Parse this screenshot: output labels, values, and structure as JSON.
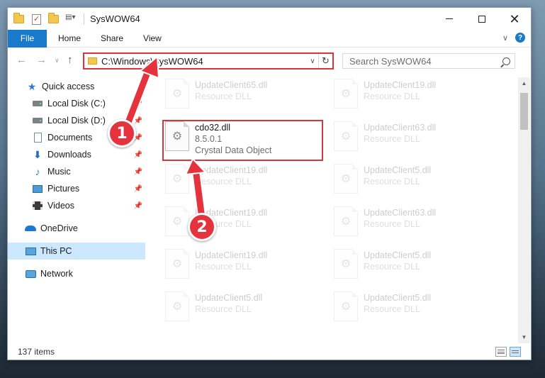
{
  "window": {
    "title": "SysWOW64"
  },
  "ribbon": {
    "tabs": [
      "File",
      "Home",
      "Share",
      "View"
    ],
    "help_label": "?"
  },
  "address": {
    "path": "C:\\Windows\\SysWOW64"
  },
  "search": {
    "placeholder": "Search SysWOW64"
  },
  "sidebar": {
    "items": [
      {
        "label": "Quick access",
        "icon": "star-icon",
        "pinned": false
      },
      {
        "label": "Local Disk (C:)",
        "icon": "drive-icon",
        "pinned": true
      },
      {
        "label": "Local Disk (D:)",
        "icon": "drive-icon",
        "pinned": true
      },
      {
        "label": "Documents",
        "icon": "documents-icon",
        "pinned": true
      },
      {
        "label": "Downloads",
        "icon": "download-icon",
        "pinned": true
      },
      {
        "label": "Music",
        "icon": "music-icon",
        "pinned": true
      },
      {
        "label": "Pictures",
        "icon": "pictures-icon",
        "pinned": true
      },
      {
        "label": "Videos",
        "icon": "videos-icon",
        "pinned": true
      },
      {
        "label": "OneDrive",
        "icon": "cloud-icon",
        "pinned": false
      },
      {
        "label": "This PC",
        "icon": "computer-icon",
        "pinned": false,
        "selected": true
      },
      {
        "label": "Network",
        "icon": "network-icon",
        "pinned": false
      }
    ]
  },
  "files": {
    "highlighted": {
      "name": "cdo32.dll",
      "version": "8.5.0.1",
      "description": "Crystal Data Object"
    },
    "column1": [
      {
        "name": "UpdateClient65.dll",
        "type": "Resource DLL"
      },
      {
        "name": "UpdateClient19.dll",
        "type": "Resource DLL"
      },
      {
        "name": "UpdateClient19.dll",
        "type": "Resource DLL"
      },
      {
        "name": "UpdateClient19.dll",
        "type": "Resource DLL"
      },
      {
        "name": "UpdateClient5.dll",
        "type": "Resource DLL"
      }
    ],
    "column2": [
      {
        "name": "UpdateClient19.dll",
        "type": "Resource DLL"
      },
      {
        "name": "UpdateClient63.dll",
        "type": "Resource DLL"
      },
      {
        "name": "UpdateClient5.dll",
        "type": "Resource DLL"
      },
      {
        "name": "UpdateClient63.dll",
        "type": "Resource DLL"
      },
      {
        "name": "UpdateClient5.dll",
        "type": "Resource DLL"
      },
      {
        "name": "UpdateClient5.dll",
        "type": "Resource DLL"
      }
    ]
  },
  "status": {
    "item_count": "137 items"
  },
  "annotations": {
    "step1": "1",
    "step2": "2",
    "color": "#e5333d"
  }
}
